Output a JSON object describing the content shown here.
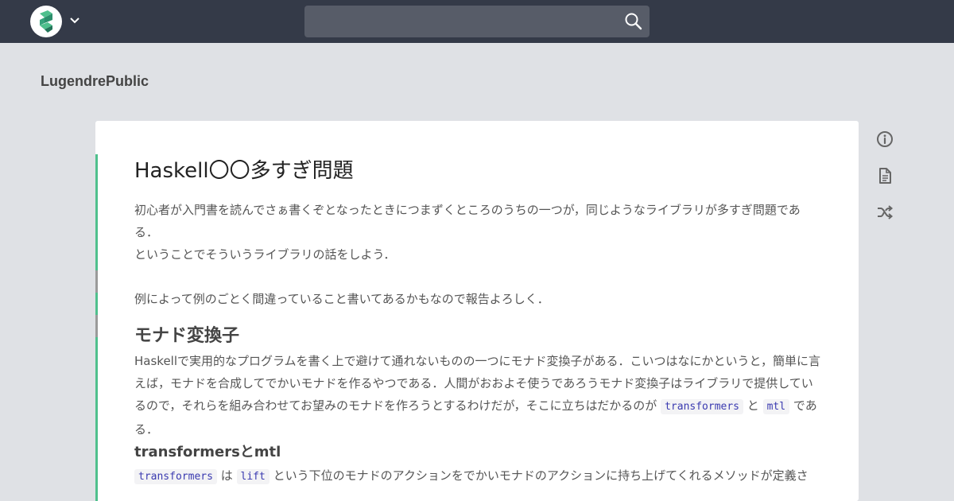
{
  "header": {
    "search_placeholder": "",
    "icons": [
      "app-logo-icon",
      "chevron-down-icon",
      "search-icon"
    ]
  },
  "workspace": {
    "name": "LugendrePublic"
  },
  "article": {
    "title": "Haskell〇〇多すぎ問題",
    "intro_1": "初心者が入門書を読んでさぁ書くぞとなったときにつまずくところのうちの一つが，同じようなライブラリが多すぎ問題である．",
    "intro_2": "ということでそういうライブラリの話をしよう．",
    "intro_3": "例によって例のごとく間違っていること書いてあるかもなので報告よろしく．",
    "section_1": {
      "heading": "モナド変換子",
      "text_before": "Haskellで実用的なプログラムを書く上で避けて通れないものの一つにモナド変換子がある．こいつはなにかというと，簡単に言えば，モナドを合成してでかいモナドを作るやつである．人間がおおよそ使うであろうモナド変換子はライブラリで提供しているので，それらを組み合わせてお望みのモナドを作ろうとするわけだが，そこに立ちはだかるのが",
      "code_1": "transformers",
      "joiner": "と",
      "code_2": "mtl",
      "text_after": "である．"
    },
    "section_2": {
      "heading": "transformersとmtl",
      "code_1": "transformers",
      "joiner": "は",
      "code_2": "lift",
      "text_after": "という下位のモナドのアクションをでかいモナドのアクションに持ち上げてくれるメソッドが定義さ"
    }
  },
  "side_toolbar": {
    "icons": [
      "info-icon",
      "document-icon",
      "shuffle-icon"
    ]
  }
}
